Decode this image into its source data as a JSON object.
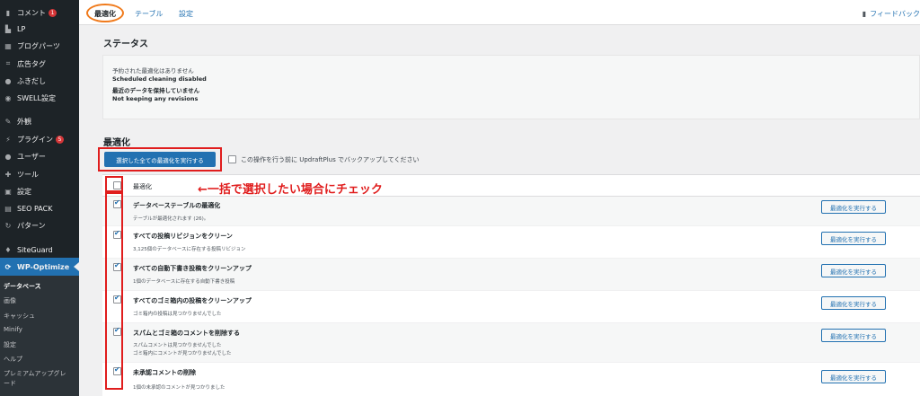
{
  "sidebar": {
    "items": [
      {
        "label": "コメント",
        "icon": "comment-icon",
        "badge": "1"
      },
      {
        "label": "LP",
        "icon": "lp-icon"
      },
      {
        "label": "ブログパーツ",
        "icon": "blocks-icon"
      },
      {
        "label": "広告タグ",
        "icon": "ad-tag-icon"
      },
      {
        "label": "ふきだし",
        "icon": "speech-bubble-icon"
      },
      {
        "label": "SWELL設定",
        "icon": "swell-icon"
      },
      {
        "label": "外観",
        "icon": "appearance-icon"
      },
      {
        "label": "プラグイン",
        "icon": "plugin-icon",
        "badge": "5"
      },
      {
        "label": "ユーザー",
        "icon": "user-icon"
      },
      {
        "label": "ツール",
        "icon": "tools-icon"
      },
      {
        "label": "設定",
        "icon": "settings-icon"
      },
      {
        "label": "SEO PACK",
        "icon": "seo-pack-icon"
      },
      {
        "label": "パターン",
        "icon": "pattern-icon"
      },
      {
        "label": "SiteGuard",
        "icon": "siteguard-icon"
      },
      {
        "label": "WP-Optimize",
        "icon": "wp-optimize-icon"
      }
    ],
    "submenu": [
      "データベース",
      "画像",
      "キャッシュ",
      "Minify",
      "設定",
      "ヘルプ",
      "プレミアムアップグレ",
      "ード"
    ]
  },
  "tabs": [
    "最適化",
    "テーブル",
    "設定"
  ],
  "feedback": "フィードバック",
  "status": {
    "title": "ステータス",
    "lines": [
      "予約された最適化はありません",
      "Scheduled cleaning disabled",
      "最近のデータを保持していません",
      "Not keeping any revisions"
    ]
  },
  "optimize": {
    "title": "最適化",
    "run_all_label": "選択した全ての最適化を実行する",
    "backup_label": "この操作を行う前に UpdraftPlus でバックアップしてください",
    "header_label": "最適化",
    "annotation": "←一括で選択したい場合にチェック",
    "button_label": "最適化を実行する",
    "rows": [
      {
        "title": "データベーステーブルの最適化",
        "desc": [
          "テーブルが最適化されます (26)。"
        ]
      },
      {
        "title": "すべての投稿リビジョンをクリーン",
        "desc": [
          "3,125個のデータベースに存在する投稿リビジョン"
        ]
      },
      {
        "title": "すべての自動下書き投稿をクリーンアップ",
        "desc": [
          "1個のデータベースに存在する自動下書き投稿"
        ]
      },
      {
        "title": "すべてのゴミ箱内の投稿をクリーンアップ",
        "desc": [
          "ゴミ箱内の投稿は見つかりませんでした"
        ]
      },
      {
        "title": "スパムとゴミ箱のコメントを削除する",
        "desc": [
          "スパムコメントは見つかりませんでした",
          "ゴミ箱内にコメントが見つかりませんでした"
        ]
      },
      {
        "title": "未承認コメントの削除",
        "desc": [
          "1個の未承認のコメントが見つかりました"
        ]
      }
    ]
  }
}
